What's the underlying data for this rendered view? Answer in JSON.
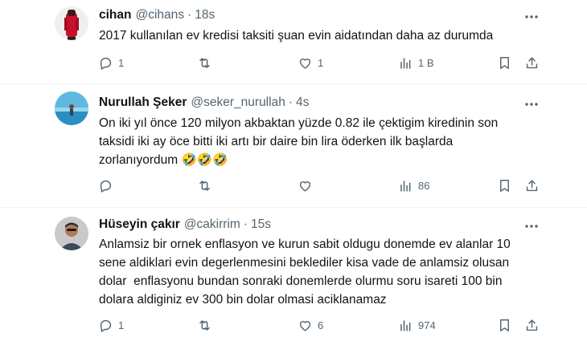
{
  "tweets": [
    {
      "display_name": "cihan",
      "handle": "@cihans",
      "dot": "·",
      "time": "18s",
      "text_lines": [
        "2017 kullanılan ev kredisi taksiti şuan evin aidatından daha az durumda"
      ],
      "counts": {
        "replies": "1",
        "retweets": "",
        "likes": "1",
        "views": "1 B"
      }
    },
    {
      "display_name": "Nurullah Şeker",
      "handle": "@seker_nurullah",
      "dot": "·",
      "time": "4s",
      "text_lines": [
        "On iki yıl önce 120 milyon akbaktan yüzde 0.82 ile çektigim kiredinin son",
        "taksidi iki ay öce bitti iki artı bir daire bin lira öderken ilk başlarda",
        "zorlanıyordum 🤣🤣🤣"
      ],
      "counts": {
        "replies": "",
        "retweets": "",
        "likes": "",
        "views": "86"
      }
    },
    {
      "display_name": "Hüseyin çakır",
      "handle": "@cakirrim",
      "dot": "·",
      "time": "15s",
      "text_lines": [
        "Anlamsiz bir ornek enflasyon ve kurun sabit oldugu donemde ev alanlar 10",
        "sene aldiklari evin degerlenmesini beklediler kisa vade de anlamsiz olusan",
        "dolar  enflasyonu bundan sonraki donemlerde olurmu soru isareti 100 bin",
        "dolara aldiginiz ev 300 bin dolar olmasi aciklanamaz"
      ],
      "counts": {
        "replies": "1",
        "retweets": "",
        "likes": "6",
        "views": "974"
      }
    }
  ],
  "icons": {
    "reply": "reply-icon",
    "retweet": "retweet-icon",
    "like": "heart-icon",
    "views": "views-icon",
    "bookmark": "bookmark-icon",
    "share": "share-icon",
    "more": "more-icon"
  },
  "colors": {
    "text": "#0f1419",
    "secondary": "#536471",
    "divider": "#eff3f4"
  }
}
